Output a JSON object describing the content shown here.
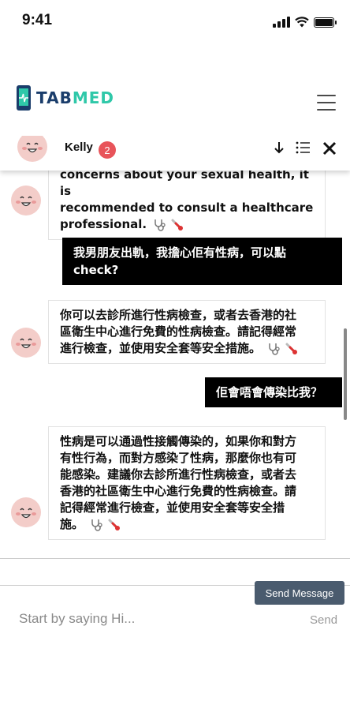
{
  "status_bar": {
    "time": "9:41"
  },
  "header": {
    "logo_tab": "TAB",
    "logo_med": "MED",
    "menu_icon": "hamburger-icon"
  },
  "chat_header": {
    "contact_name": "Kelly",
    "unread_count": "2",
    "icons": [
      "arrow-down-icon",
      "list-icon",
      "close-icon"
    ]
  },
  "messages": [
    {
      "from": "bot",
      "lines": [
        "concerns about your sexual health, it is",
        "recommended to consult a healthcare",
        "professional."
      ]
    },
    {
      "from": "user",
      "lines": [
        "我男朋友出軌，我擔心佢有性病，可以點",
        "check?"
      ]
    },
    {
      "from": "bot",
      "lines": [
        "你可以去診所進行性病檢查，或者去香港的社",
        "區衛生中心進行免費的性病檢查。請記得經常",
        "進行檢查，並使用安全套等安全措施。"
      ]
    },
    {
      "from": "user",
      "lines": [
        "佢會唔會傳染比我？"
      ]
    },
    {
      "from": "bot",
      "lines": [
        "性病是可以通過性接觸傳染的，如果你和對方",
        "有性行為，而對方感染了性病，那麼你也有可",
        "能感染。建議你去診所進行性病檢查，或者去",
        "香港的社區衛生中心進行免費的性病檢查。請",
        "記得經常進行檢查，並使用安全套等安全措",
        "施。"
      ]
    }
  ],
  "composer": {
    "tooltip": "Send Message",
    "placeholder": "Start by saying Hi...",
    "send_label": "Send"
  },
  "colors": {
    "brand_dark": "#1a3d6b",
    "brand_teal": "#2fc8a9",
    "badge": "#e8545a",
    "tooltip_bg": "#4a5b6e"
  }
}
